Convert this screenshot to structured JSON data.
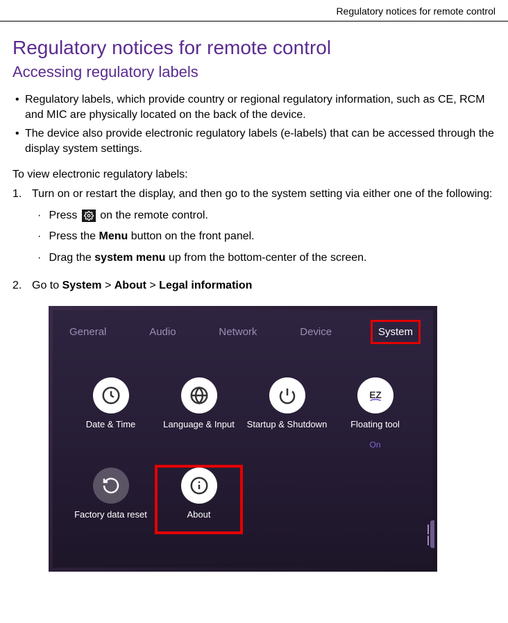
{
  "runhead": "Regulatory notices for remote control",
  "h1": "Regulatory notices for remote control",
  "h2": "Accessing regulatory labels",
  "bullets": [
    "Regulatory labels, which provide country or regional regulatory information, such as CE, RCM and MIC are physically located on the back of the device.",
    "The device also provide electronic regulatory labels (e-labels) that can be accessed through the display system settings."
  ],
  "intro": "To view electronic regulatory labels:",
  "step1": {
    "num": "1.",
    "text": "Turn on or restart the display, and then go to the system setting via either one of the following:",
    "sub_a_pre": "Press ",
    "sub_a_post": " on the remote control.",
    "sub_b_pre": "Press the ",
    "sub_b_bold": "Menu",
    "sub_b_post": " button on the front panel.",
    "sub_c_pre": "Drag the ",
    "sub_c_bold": "system menu",
    "sub_c_post": " up from the bottom-center of the screen."
  },
  "step2": {
    "num": "2.",
    "pre": "Go to ",
    "p1": "System",
    "s1": " > ",
    "p2": "About",
    "s2": " > ",
    "p3": "Legal information"
  },
  "shot": {
    "tabs": [
      "General",
      "Audio",
      "Network",
      "Device",
      "System"
    ],
    "tiles": [
      {
        "label": "Date & Time",
        "icon": "clock",
        "style": "solid"
      },
      {
        "label": "Language & Input",
        "icon": "globe",
        "style": "solid"
      },
      {
        "label": "Startup & Shutdown",
        "icon": "power",
        "style": "solid"
      },
      {
        "label": "Floating tool",
        "sub": "On",
        "icon": "ez",
        "style": "solid"
      },
      {
        "label": "Factory data reset",
        "icon": "reset",
        "style": "dim"
      },
      {
        "label": "About",
        "icon": "info",
        "style": "solid",
        "highlight": true
      }
    ]
  }
}
